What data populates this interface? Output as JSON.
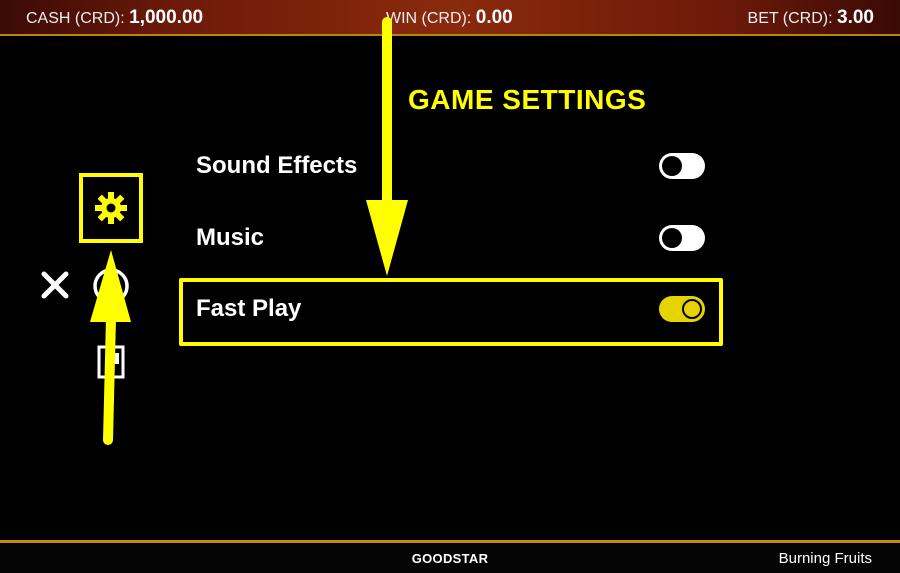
{
  "status_bar": {
    "cash_label": "CASH (CRD):",
    "cash_value": "1,000.00",
    "win_label": "WIN (CRD):",
    "win_value": "0.00",
    "bet_label": "BET (CRD):",
    "bet_value": "3.00"
  },
  "settings": {
    "title": "GAME SETTINGS",
    "items": [
      {
        "label": "Sound Effects",
        "enabled": false
      },
      {
        "label": "Music",
        "enabled": false
      },
      {
        "label": "Fast Play",
        "enabled": true
      }
    ]
  },
  "side_menu": {
    "icons": [
      "gear-icon",
      "close-icon",
      "info-icon",
      "paytable-icon"
    ]
  },
  "footer": {
    "brand": "GOODSTAR",
    "game_name": "Burning Fruits"
  },
  "colors": {
    "highlight": "#ffff00",
    "toggle_on": "#e6d400",
    "background": "#000000"
  }
}
